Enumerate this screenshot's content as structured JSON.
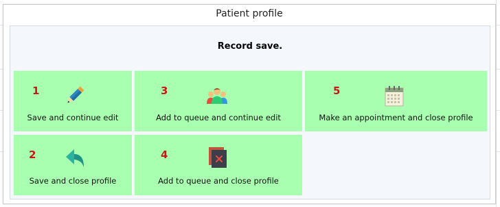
{
  "dialog": {
    "title": "Patient profile",
    "message": "Record save."
  },
  "actions": [
    {
      "number": "1",
      "label": "Save and continue edit",
      "icon": "pencil-icon"
    },
    {
      "number": "3",
      "label": "Add to queue and continue edit",
      "icon": "people-icon"
    },
    {
      "number": "5",
      "label": "Make an appointment and close profile",
      "icon": "calendar-icon"
    },
    {
      "number": "2",
      "label": "Save and close profile",
      "icon": "reply-arrow-icon"
    },
    {
      "number": "4",
      "label": "Add to queue and close profile",
      "icon": "close-window-icon"
    }
  ],
  "colors": {
    "tile_background": "#a8ffb0",
    "number_color": "#cc1616",
    "body_background": "#f4f8fc"
  }
}
